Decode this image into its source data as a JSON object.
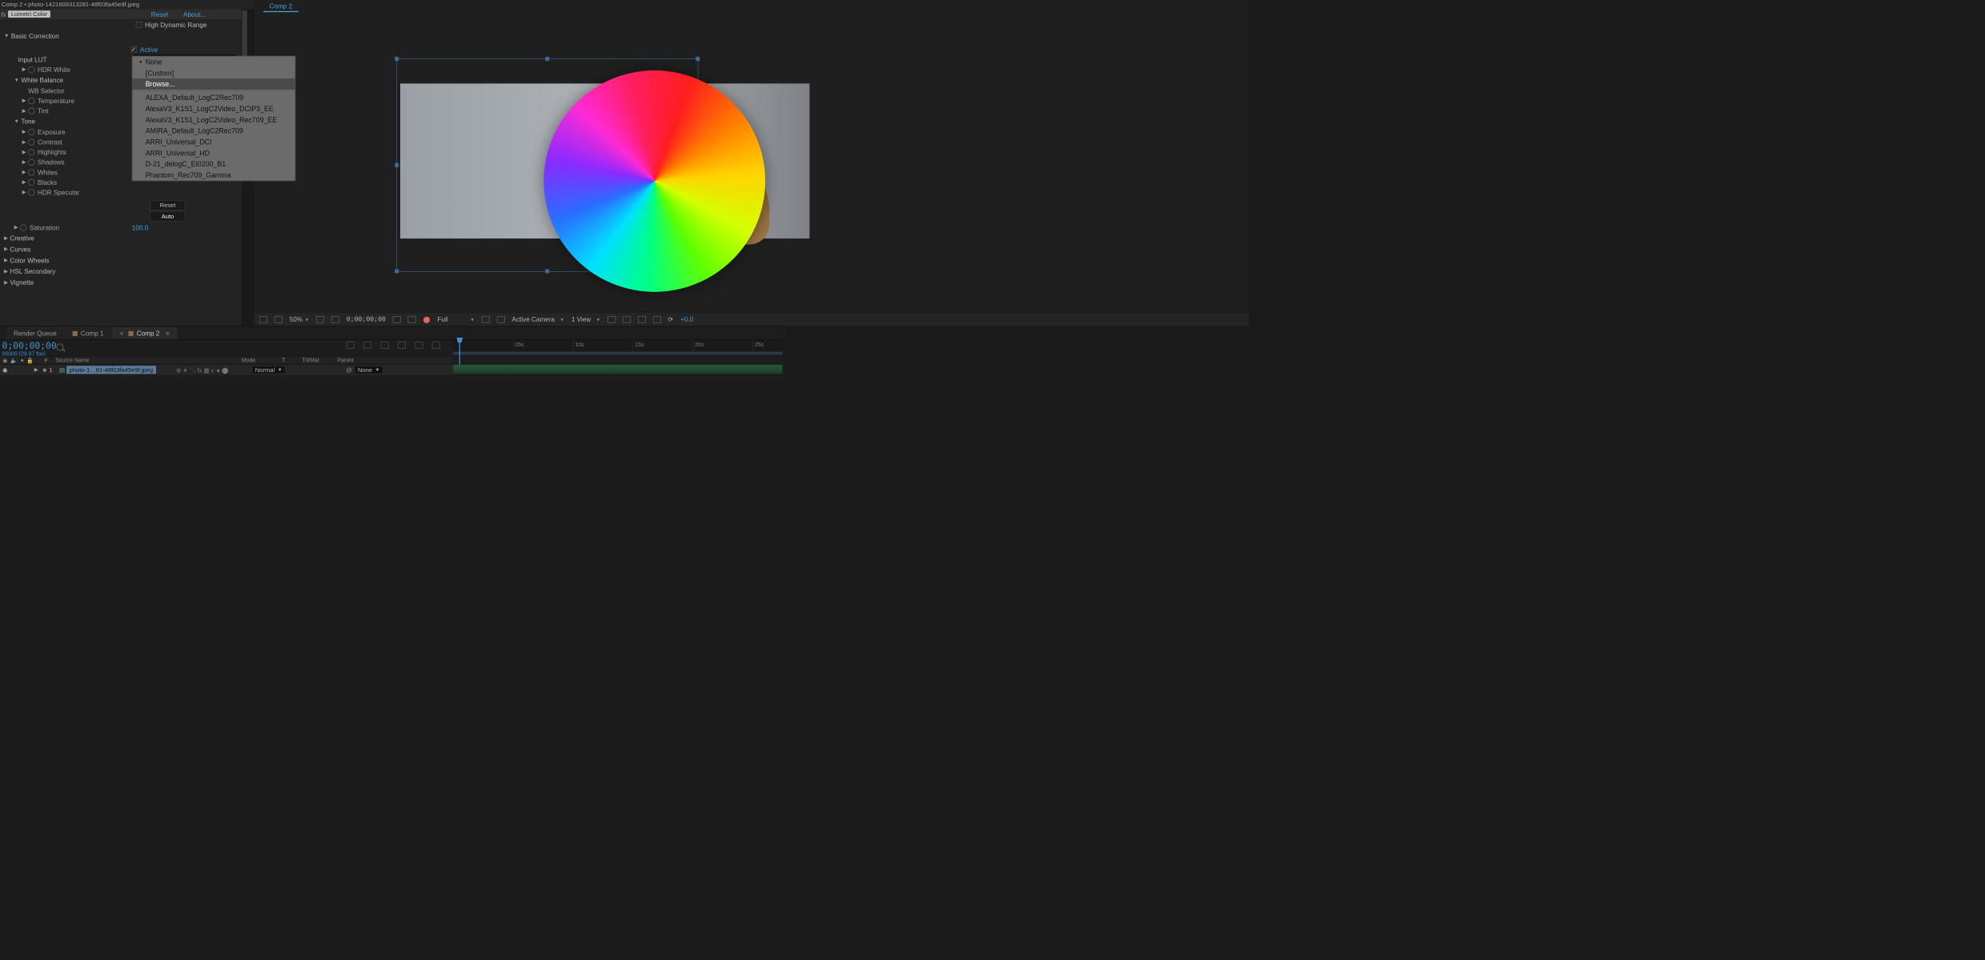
{
  "tab_title": "Comp 2 • photo-1421809313281-48f03fa45e9f.jpeg",
  "effect": {
    "fx_prefix": "fx",
    "name": "Lumetri Color",
    "reset": "Reset",
    "about": "About...",
    "hdr": "High Dynamic Range",
    "basic": "Basic Correction",
    "input_lut_label": "Input LUT",
    "active": "Active",
    "lut_value": "None",
    "hdr_white": "HDR White",
    "wb_section": "White Balance",
    "wb_selector": "WB Selector",
    "temperature": "Temperature",
    "tint": "Tint",
    "tone_section": "Tone",
    "exposure": "Exposure",
    "contrast": "Contrast",
    "highlights": "Highlights",
    "shadows": "Shadows",
    "whites": "Whites",
    "blacks": "Blacks",
    "hdr_specular": "HDR Specular",
    "reset_btn": "Reset",
    "auto_btn": "Auto",
    "saturation": "Saturation",
    "saturation_val": "100.0",
    "creative": "Creative",
    "curves": "Curves",
    "wheels": "Color Wheels",
    "hsl": "HSL Secondary",
    "vignette": "Vignette"
  },
  "lut_menu": {
    "none": "None",
    "custom": "[Custom]",
    "browse": "Browse...",
    "items": [
      "ALEXA_Default_LogC2Rec709",
      "AlexaV3_K1S1_LogC2Video_DCIP3_EE",
      "AlexaV3_K1S1_LogC2Video_Rec709_EE",
      "AMIRA_Default_LogC2Rec709",
      "ARRI_Universal_DCI",
      "ARRI_Universal_HD",
      "D-21_delogC_EI0200_B1",
      "Phantom_Rec709_Gamma"
    ]
  },
  "viewer": {
    "tab": "Comp 2",
    "zoom": "50%",
    "timecode": "0;00;00;00",
    "res": "Full",
    "camera": "Active Camera",
    "views": "1 View",
    "exposure": "+0.0"
  },
  "timeline": {
    "tabs": {
      "render": "Render Queue",
      "comp1": "Comp 1",
      "comp2": "Comp 2"
    },
    "timecode": "0;00;00;00",
    "fps_line": "00000 (29.97 fps)",
    "ruler": [
      "05s",
      "10s",
      "15s",
      "20s",
      "25s"
    ],
    "cols": {
      "num": "#",
      "source": "Source Name",
      "mode": "Mode",
      "t": "T",
      "trkmat": "TrkMat",
      "parent": "Parent"
    },
    "layer": {
      "idx": "1",
      "name": "photo-1…81-48f03fa45e9f.jpeg",
      "mode": "Normal",
      "parent": "None"
    }
  }
}
